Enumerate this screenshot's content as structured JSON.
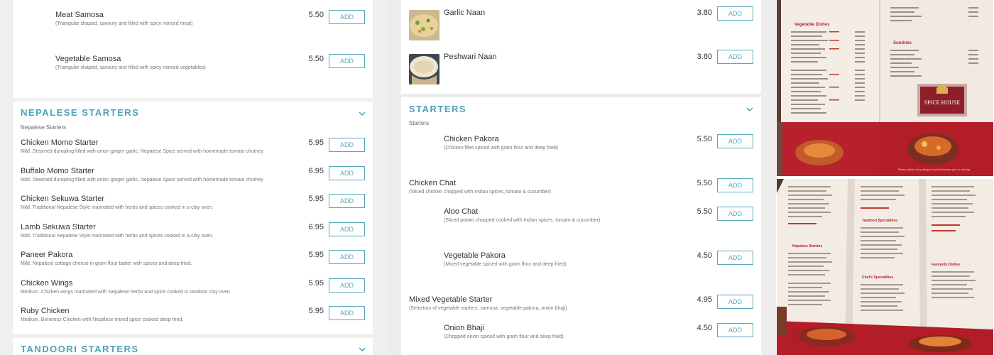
{
  "left": {
    "top_items": [
      {
        "name": "Meat Samosa",
        "desc": "(Triangular shaped, savoury and filled with spicy minced meat)",
        "price": "5.50",
        "add": "ADD"
      },
      {
        "name": "Vegetable Samosa",
        "desc": "(Triangular shaped, savoury and filled with spicy minced vegetables)",
        "price": "5.50",
        "add": "ADD"
      }
    ],
    "nepalese": {
      "title": "NEPALESE STARTERS",
      "subtitle": "Nepalese Starters",
      "items": [
        {
          "name": "Chicken Momo Starter",
          "desc": "Mild. Steamed dumpling filled with onion ginger garlic, Nepalese Spice served with homemade tomato chutney",
          "price": "5.95",
          "add": "ADD"
        },
        {
          "name": "Buffalo Momo Starter",
          "desc": "Mild. Steamed dumpling filled with onion ginger garlic, Nepalese Spice served with homemade tomato chutney",
          "price": "6.95",
          "add": "ADD"
        },
        {
          "name": "Chicken Sekuwa Starter",
          "desc": "Mild. Traditional Nepalese Style marinated with herbs and spices cooked in a clay oven.",
          "price": "5.95",
          "add": "ADD"
        },
        {
          "name": "Lamb Sekuwa Starter",
          "desc": "Mild. Traditional Nepalese Style marinated with herbs and spices cooked in a clay oven.",
          "price": "6.95",
          "add": "ADD"
        },
        {
          "name": "Paneer Pakora",
          "desc": "Mild. Nepalese cottage cheese in gram flour batter with spices and deep fried.",
          "price": "5.95",
          "add": "ADD"
        },
        {
          "name": "Chicken Wings",
          "desc": "Medium. Chicken wings marinated with Nepalese herbs and spice cooked in tandoori clay oven",
          "price": "5.95",
          "add": "ADD"
        },
        {
          "name": "Ruby Chicken",
          "desc": "Medium. Boneless Chicken with Nepalese mixed spice cooked deep fried.",
          "price": "5.95",
          "add": "ADD"
        }
      ]
    },
    "tandoori": {
      "title": "TANDOORI STARTERS"
    }
  },
  "mid": {
    "breads": [
      {
        "name": "Garlic Naan",
        "price": "3.80",
        "add": "ADD"
      },
      {
        "name": "Peshwari Naan",
        "price": "3.80",
        "add": "ADD"
      }
    ],
    "starters": {
      "title": "STARTERS",
      "subtitle": "Starters",
      "items": [
        {
          "name": "Chicken Pakora",
          "desc": "(Chicken fillet spiced with gram flour and deep fried)",
          "price": "5.50",
          "add": "ADD"
        },
        {
          "name": "Chicken Chat",
          "desc": "(Sliced chicken chopped with Indian spices, tomato & cucumber)",
          "price": "5.50",
          "add": "ADD"
        },
        {
          "name": "Aloo Chat",
          "desc": "(Sliced potato chopped cooked with Indian spices, tomato & cucumber)",
          "price": "5.50",
          "add": "ADD"
        },
        {
          "name": "Vegetable Pakora",
          "desc": "(Mixed vegetable spiced with gram flour and deep fried)",
          "price": "4.50",
          "add": "ADD"
        },
        {
          "name": "Mixed Vegetable Starter",
          "desc": "(Selection of vegetable starters: samosa, vegetable pakora, onion bhaji)",
          "price": "4.95",
          "add": "ADD"
        },
        {
          "name": "Onion Bhaji",
          "desc": "(Chopped onion spiced with gram flour and deep fried)",
          "price": "4.50",
          "add": "ADD"
        }
      ]
    }
  },
  "photos": {
    "top": {
      "brand": "SPICE HOUSE",
      "heading_left": "Vegetable Dishes",
      "heading_right": "Sundries",
      "footer": "Please advise of any allergy or food intolerances prior to ordering."
    },
    "bottom": {
      "heading_a": "Tandoori Specialities",
      "heading_b": "Chef's Specialities",
      "heading_c": "Nepalese Starters",
      "heading_d": "Favourite Dishes"
    }
  },
  "colors": {
    "accent": "#4aa3b8",
    "menu_red": "#b5232c",
    "menu_paper": "#f4ede6"
  }
}
